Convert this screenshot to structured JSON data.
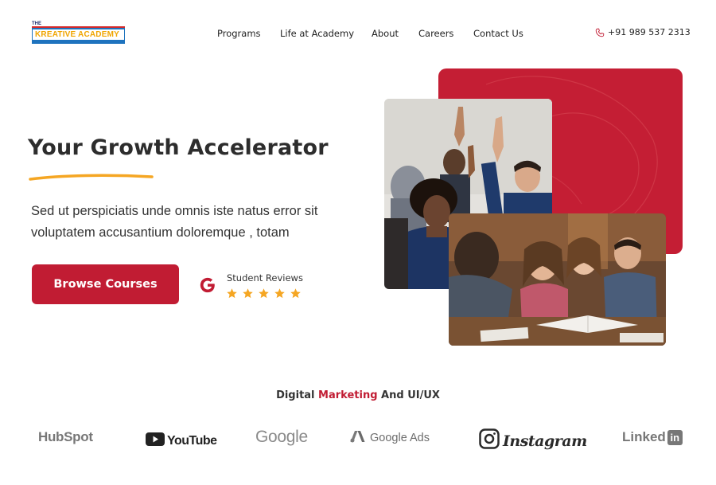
{
  "header": {
    "logo": {
      "top_text": "THE",
      "main_text": "KREATIVE ACADEMY"
    },
    "nav": [
      {
        "label": "Programs"
      },
      {
        "label": "Life at Academy"
      },
      {
        "label": "About"
      },
      {
        "label": "Careers"
      },
      {
        "label": "Contact Us"
      }
    ],
    "phone": {
      "icon": "phone-icon",
      "number": "+91 989 537 2313"
    }
  },
  "hero": {
    "title": "Your Growth Accelerator",
    "description": "Sed ut perspiciatis unde omnis iste natus error sit voluptatem accusantium doloremque , totam",
    "cta_label": "Browse Courses",
    "reviews": {
      "label": "Student Reviews",
      "rating": 5,
      "max": 5,
      "icon": "google-g-icon"
    }
  },
  "brands": {
    "heading_prefix": "Digital ",
    "heading_accent": "Marketing",
    "heading_suffix": " And UI/UX",
    "logos": [
      {
        "name": "HubSpot",
        "text": "HubSpot"
      },
      {
        "name": "YouTube",
        "text": "YouTube"
      },
      {
        "name": "Google",
        "text": "Google"
      },
      {
        "name": "Google Ads",
        "text": "Google Ads"
      },
      {
        "name": "Instagram",
        "text": "Instagram"
      },
      {
        "name": "LinkedIn",
        "text": "Linked",
        "badge": "in"
      }
    ]
  },
  "colors": {
    "accent": "#c11c33",
    "underline": "#f5a623",
    "star": "#f5a623",
    "logo_blue": "#1e73be"
  }
}
